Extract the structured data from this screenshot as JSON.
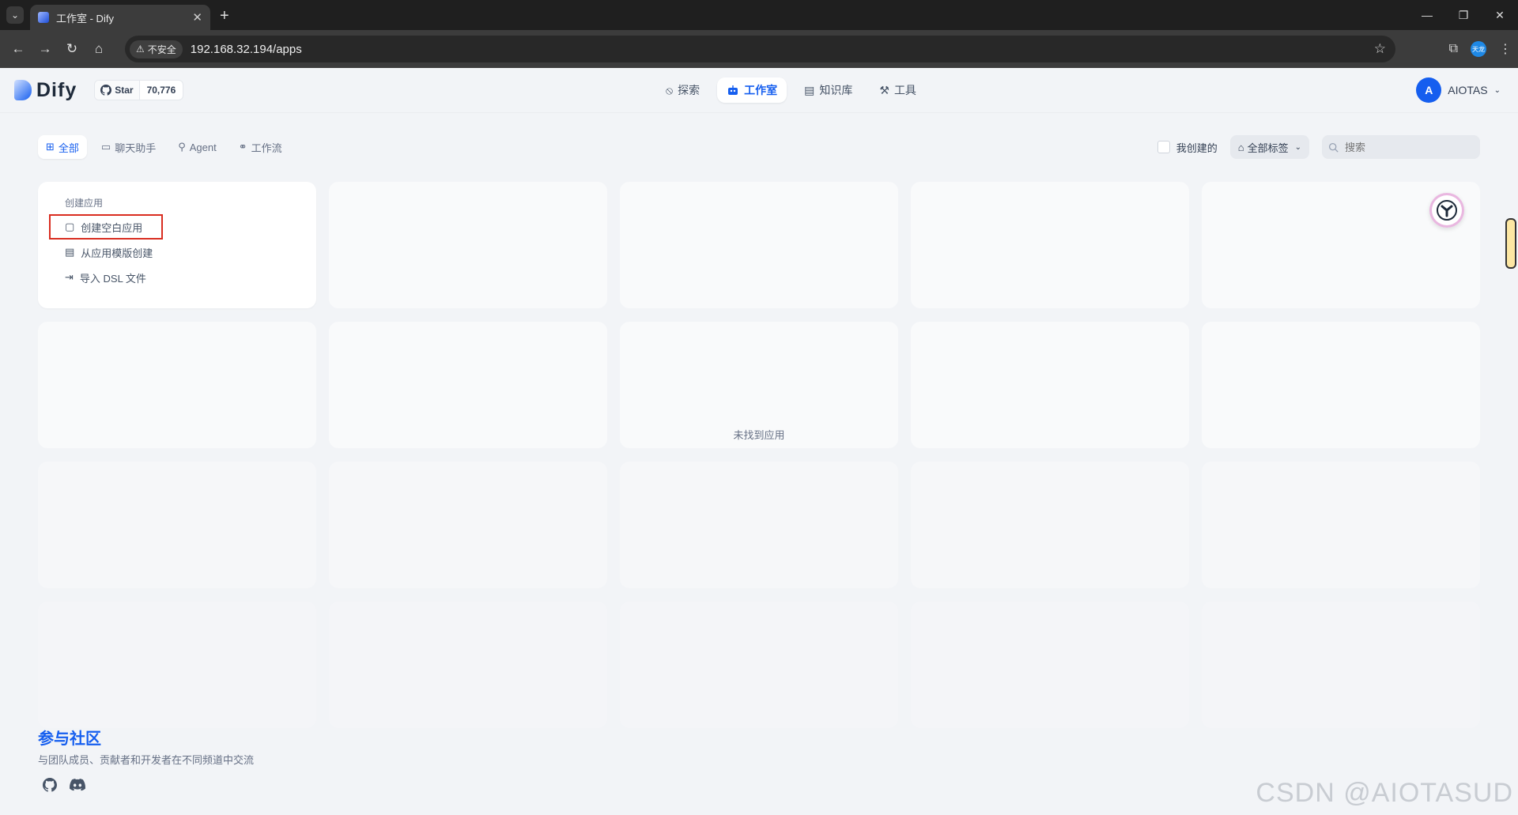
{
  "browser": {
    "tab_title": "工作室 - Dify",
    "security_label": "不安全",
    "url": "192.168.32.194/apps",
    "profile_label": "天龙"
  },
  "header": {
    "logo_text": "Dify",
    "github": {
      "star_label": "Star",
      "star_count": "70,776"
    },
    "nav": [
      {
        "label": "探索",
        "icon": "compass-icon"
      },
      {
        "label": "工作室",
        "icon": "robot-icon",
        "active": true
      },
      {
        "label": "知识库",
        "icon": "book-icon"
      },
      {
        "label": "工具",
        "icon": "hammer-icon"
      }
    ],
    "user": {
      "avatar_letter": "A",
      "name": "AIOTAS"
    }
  },
  "filters": {
    "tabs": [
      {
        "label": "全部",
        "icon": "grid-icon",
        "active": true
      },
      {
        "label": "聊天助手",
        "icon": "chat-icon"
      },
      {
        "label": "Agent",
        "icon": "agent-icon"
      },
      {
        "label": "工作流",
        "icon": "workflow-icon"
      }
    ],
    "mine_label": "我创建的",
    "tags_label": "全部标签",
    "search_placeholder": "搜索"
  },
  "create_card": {
    "title": "创建应用",
    "items": [
      {
        "label": "创建空白应用",
        "icon": "file-plus-icon",
        "highlighted": true
      },
      {
        "label": "从应用模版创建",
        "icon": "template-icon"
      },
      {
        "label": "导入 DSL 文件",
        "icon": "import-icon"
      }
    ]
  },
  "empty_text": "未找到应用",
  "community": {
    "title": "参与社区",
    "subtitle": "与团队成员、贡献者和开发者在不同频道中交流"
  },
  "watermark": "CSDN @AIOTASUD",
  "colors": {
    "accent": "#155eef",
    "highlight_border": "#d92d20"
  }
}
